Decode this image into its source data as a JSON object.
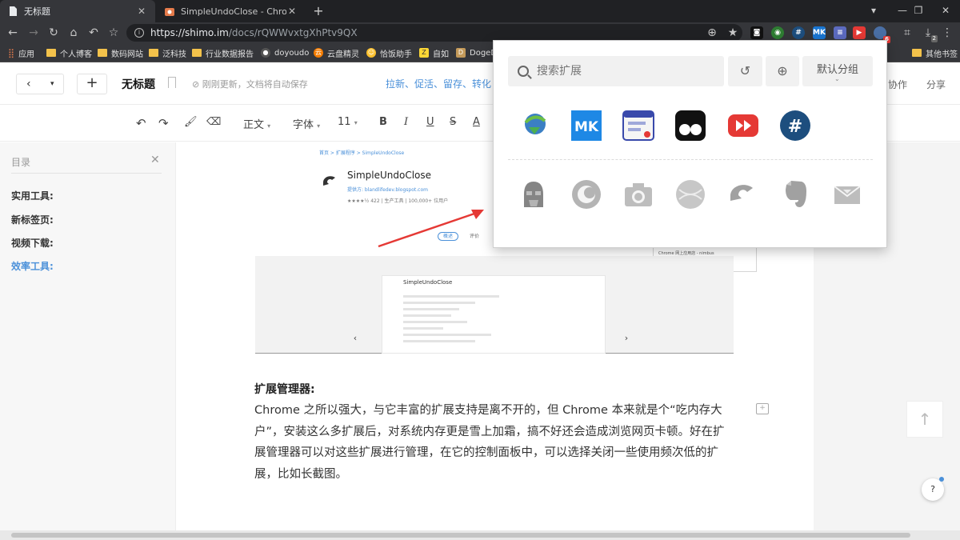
{
  "browser": {
    "tabs": [
      {
        "title": "无标题",
        "active": true
      },
      {
        "title": "SimpleUndoClose - Chrome 网",
        "active": false
      }
    ],
    "url_host": "https://shimo.im",
    "url_path": "/docs/rQWWvxtgXhPtv9QX",
    "bookmarks": [
      "应用",
      "个人博客",
      "数码网站",
      "泛科技",
      "行业数据报告",
      "doyoudo",
      "云盘精灵",
      "恰饭助手",
      "自如",
      "DogeD",
      "其他书签"
    ],
    "ext_badges": {
      "red": "6",
      "download": "2"
    }
  },
  "doc_header": {
    "title": "无标题",
    "save_status": "刚刚更新，文档将自动保存",
    "promo": "拉新、促活、留存、转化",
    "collab": "协作",
    "share": "分享"
  },
  "format_bar": {
    "paragraph": "正文",
    "font": "字体",
    "size": "11"
  },
  "sidebar": {
    "title": "目录",
    "items": [
      "实用工具:",
      "新标签页:",
      "视频下载:",
      "效率工具:"
    ]
  },
  "embedded_screenshot": {
    "crumb": "首页  >  扩展程序  >  SimpleUndoClose",
    "title": "SimpleUndoClose",
    "provider": "提供方: blandlifedev.blogspot.com",
    "meta": "★★★★½  422  |  生产工具  |  100,000+ 位用户",
    "tab_overview": "概述",
    "tab_reviews": "评价",
    "inner_title": "SimpleUndoClose",
    "popover_text": "Chrome 网上应用店 - nimbus"
  },
  "content": {
    "section_title": "扩展管理器:",
    "paragraph": "Chrome 之所以强大，与它丰富的扩展支持是离不开的，但 Chrome 本来就是个“吃内存大户”，安装这么多扩展后，对系统内存更是雪上加霜，搞不好还会造成浏览网页卡顿。好在扩展管理器可以对这些扩展进行管理，在它的控制面板中，可以选择关闭一些使用频次低的扩展，比如长截图。"
  },
  "ext_popup": {
    "search_placeholder": "搜索扩展",
    "group_label": "默认分组",
    "enabled_icons": [
      "idm-icon",
      "mk-icon",
      "tab-manager-icon",
      "tampermonkey-icon",
      "video-speed-icon",
      "hashtag-icon"
    ],
    "disabled_icons": [
      "vader-icon",
      "chrome-cleaner-icon",
      "camera-icon",
      "globe-icon",
      "undo-close-icon",
      "evernote-icon",
      "inbox-icon"
    ]
  },
  "colors": {
    "accent": "#4a90d9",
    "chrome_dark": "#35363a",
    "arrow_red": "#e53935"
  }
}
